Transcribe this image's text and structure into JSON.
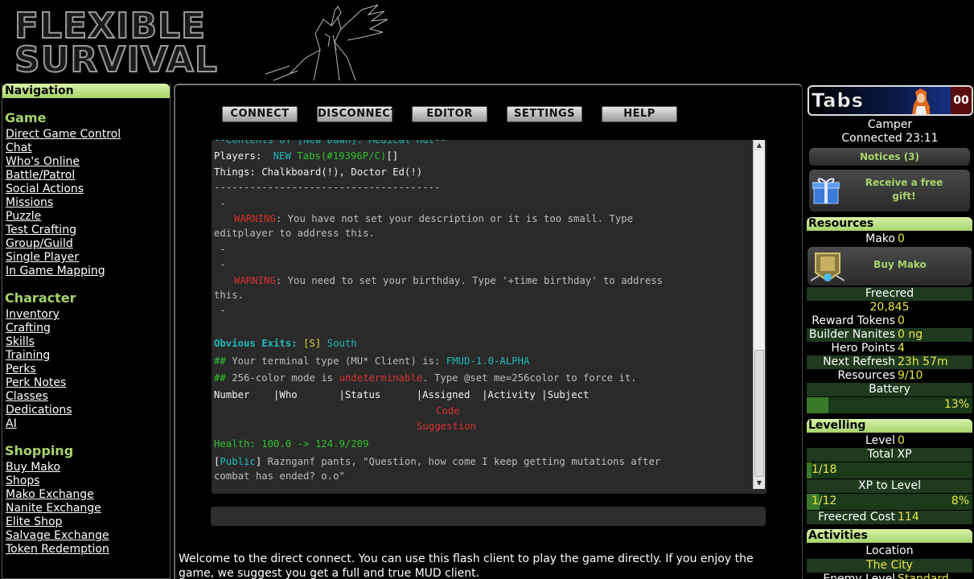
{
  "header": {
    "logo_line1": "FLEXIBLE",
    "logo_line2": "SURVIVAL"
  },
  "nav": {
    "title": "Navigation",
    "sections": [
      {
        "title": "Game",
        "items": [
          "Direct Game Control",
          "Chat",
          "Who's Online",
          "Battle/Patrol",
          "Social Actions",
          "Missions",
          "Puzzle",
          "Test Crafting",
          "Group/Guild",
          "Single Player",
          "In Game Mapping"
        ]
      },
      {
        "title": "Character",
        "items": [
          "Inventory",
          "Crafting",
          "Skills",
          "Training",
          "Perks",
          "Perk Notes",
          "Classes",
          "Dedications",
          "AI"
        ]
      },
      {
        "title": "Shopping",
        "items": [
          "Buy Mako",
          "Shops",
          "Mako Exchange",
          "Nanite Exchange",
          "Elite Shop",
          "Salvage Exchange",
          "Token Redemption"
        ]
      }
    ]
  },
  "toolbar": {
    "connect": "CONNECT",
    "disconnect": "DISCONNECT",
    "editor": "EDITOR",
    "settings": "SETTINGS",
    "help": "HELP"
  },
  "terminal": {
    "l0": "--Contents of [New Dawn]: Medical Hut--",
    "players_label": "Players: ",
    "players_new": "NEW",
    "players_name": "Tabs",
    "players_id": "(#19396P/C)",
    "players_tail": "[]",
    "things_label": "Things: ",
    "things_value": "Chalkboard(!), Doctor Ed(!)",
    "separator": "--------------------------------------",
    "dash": " -",
    "warning": "WARNING",
    "warn1_text": ": You have not set your description or it is too small. Type",
    "warn1_cont": "editplayer to address this.",
    "warn2_text": ": You need to set your birthday. Type '+time birthday' to address",
    "warn2_cont": "this.",
    "exits_label": "Obvious Exits: ",
    "exits_key": "[S]",
    "exits_dir": "South",
    "hash": "## ",
    "client_text": "Your terminal type (MU* Client) is: ",
    "client_value": "FMUD-1.0-ALPHA",
    "color_text1": "256-color mode is ",
    "color_undetermined": "undeterminable",
    "color_text2": ". Type @set me=256color to force it.",
    "table_header": "Number    |Who       |Status      |Assigned  |Activity |Subject",
    "code": "Code",
    "suggestion": "Suggestion",
    "health": "Health: 100.0 -> 124.9/209",
    "public_tag": "Public",
    "public_text1": "Raznganf pants, \"Question, how come I keep getting mutations after",
    "public_text2": "combat has ended? o.o\""
  },
  "input": {
    "value": ""
  },
  "welcome": "Welcome to the direct connect. You can use this flash client to play the game directly. If you enjoy the game, we suggest you get a full and true MUD client.",
  "profile": {
    "name": "Tabs",
    "count": "00",
    "status": "Camper",
    "connected": "Connected 23:11",
    "notices": "Notices (3)",
    "gift": "Receive a free gift!"
  },
  "resources": {
    "title": "Resources",
    "mako_label": "Mako",
    "mako_value": "0",
    "buy_mako": "Buy Mako",
    "freecred_label": "Freecred",
    "freecred_value": "20,845",
    "reward_label": "Reward Tokens",
    "reward_value": "0",
    "nanites_label": "Builder Nanites",
    "nanites_value": "0 ng",
    "hero_label": "Hero Points",
    "hero_value": "4",
    "refresh_label": "Next Refresh",
    "refresh_value": "23h 57m",
    "res_label": "Resources",
    "res_value": "9/10",
    "battery_label": "Battery",
    "battery_value": "13%",
    "battery_fraction": 0.13
  },
  "levelling": {
    "title": "Levelling",
    "level_label": "Level",
    "level_value": "0",
    "totalxp_label": "Total XP",
    "totalxp_value": "1/18",
    "xpto_label": "XP to Level",
    "xpto_value": "1/12",
    "xpto_pct": "8%",
    "xpto_fraction": 0.08,
    "freecred_cost_label": "Freecred Cost",
    "freecred_cost_value": "114"
  },
  "activities": {
    "title": "Activities",
    "location_label": "Location",
    "location_value": "The City",
    "enemy_label": "Enemy Level",
    "enemy_value": "Standard"
  },
  "colors": {
    "accent": "#a6d36c",
    "value_yellow": "#e8e844"
  }
}
